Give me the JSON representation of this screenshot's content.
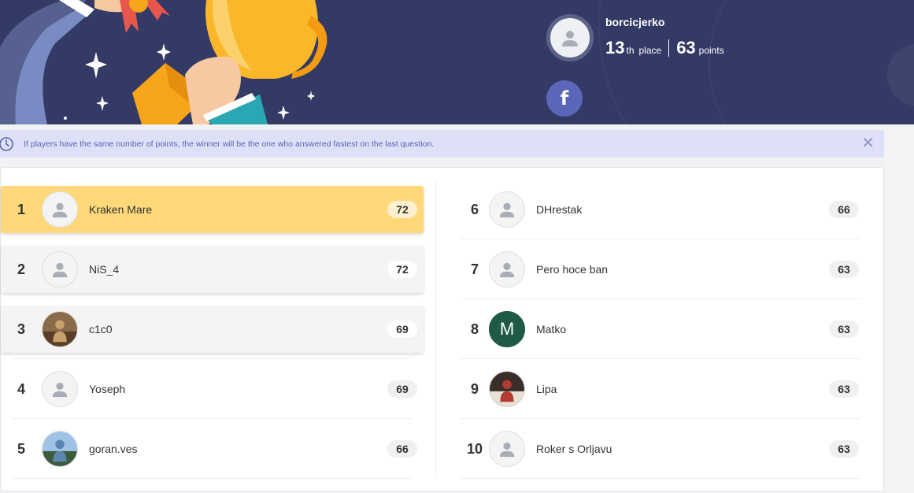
{
  "profile": {
    "username": "borcicjerko",
    "place_number": "13",
    "place_suffix": "th",
    "place_label": "place",
    "points_number": "63",
    "points_label": "points",
    "share_icon": "facebook-icon",
    "share_glyph": "f"
  },
  "notice": {
    "text": "If players have the same number of points, the winner will be the one who answered fastest on the last question.",
    "icon": "clock-icon",
    "close_glyph": "✕"
  },
  "leaderboard": [
    {
      "rank": "1",
      "name": "Kraken Mare",
      "points": "72",
      "avatar": "default-avatar-icon"
    },
    {
      "rank": "2",
      "name": "NiS_4",
      "points": "72",
      "avatar": "default-avatar-icon"
    },
    {
      "rank": "3",
      "name": "c1c0",
      "points": "69",
      "avatar": "photo-avatar"
    },
    {
      "rank": "4",
      "name": "Yoseph",
      "points": "69",
      "avatar": "default-avatar-icon"
    },
    {
      "rank": "5",
      "name": "goran.ves",
      "points": "66",
      "avatar": "photo-avatar"
    },
    {
      "rank": "6",
      "name": "DHrestak",
      "points": "66",
      "avatar": "default-avatar-icon"
    },
    {
      "rank": "7",
      "name": "Pero hoce ban",
      "points": "63",
      "avatar": "default-avatar-icon"
    },
    {
      "rank": "8",
      "name": "Matko",
      "points": "63",
      "avatar": "letter-avatar",
      "letter": "M"
    },
    {
      "rank": "9",
      "name": "Lipa",
      "points": "63",
      "avatar": "photo-avatar"
    },
    {
      "rank": "10",
      "name": "Roker s Orljavu",
      "points": "63",
      "avatar": "default-avatar-icon"
    }
  ],
  "colors": {
    "banner": "#333a66",
    "first_place": "#fed879",
    "notice_bg": "#dde0f7",
    "notice_text": "#5a63b5",
    "facebook": "#5a66b8"
  }
}
